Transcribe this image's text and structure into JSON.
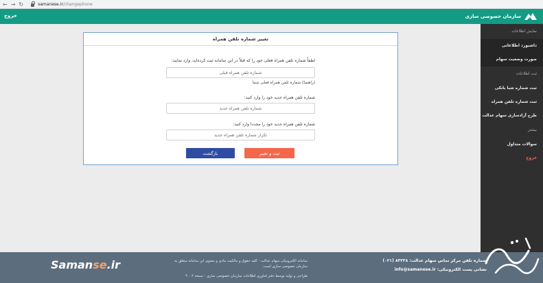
{
  "browser": {
    "back_glyph": "←",
    "forward_glyph": "→",
    "reload_glyph": "↻",
    "url_host": "samanese.ir",
    "url_path": "/changephone"
  },
  "header": {
    "logout_label": "خروج",
    "brand_name": "سازمان خصوصی سازی"
  },
  "sidebar": {
    "items": [
      {
        "label": "نمایش اطلاعات",
        "kind": "section"
      },
      {
        "label": "داشبورد اطلاعاتی",
        "kind": "item"
      },
      {
        "label": "صورت وضعیت سهام",
        "kind": "item"
      },
      {
        "label": "ثبت اطلاعات",
        "kind": "section"
      },
      {
        "label": "ثبت شماره شبا بانکی",
        "kind": "item"
      },
      {
        "label": "ثبت شماره تلفن همراه",
        "kind": "item"
      },
      {
        "label": "طرح آزادسازی سهام عدالت",
        "kind": "item"
      },
      {
        "label": "بیشتر",
        "kind": "section"
      },
      {
        "label": "سوالات متداول",
        "kind": "item"
      },
      {
        "label": "خروج",
        "kind": "exit"
      }
    ]
  },
  "form": {
    "title": "تغییر شماره تلفن همراه",
    "current_label": "لطفاً شماره تلفن همراه فعلی خود را که قبلاً در این سامانه ثبت کرده‌اید، وارد نمایید:",
    "current_placeholder": "شماره تلفن همراه قبلی",
    "current_hint": "(راهنما) شماره تلفن همراه فعلی شما",
    "new_label": "شماره تلفن همراه جدید خود را وارد کنید:",
    "new_placeholder": "شماره تلفن همراه جدید",
    "repeat_label": "شماره تلفن همراه جدید خود را مجددا وارد کنید:",
    "repeat_placeholder": "تکرار شماره تلفن همراه جدید",
    "submit_label": "ثبت و تغییر",
    "back_label": "بازگشت"
  },
  "footer": {
    "logo_main": "Saman",
    "logo_accent": "se",
    "logo_tail": ".ir",
    "notice": "سامانه الکترونیکی سهام عدالت - کلیه حقوق و مالکیت مادی و معنوی این سامانه متعلق به سازمان خصوصی سازی است.",
    "credit": "طراحی و تولید توسط دفتر فناوری اطلاعات سازمان خصوصی سازی - نسخه ۴.۰.۲",
    "phone_line": "شماره تلفن مرکز تماس سهام عدالت: ۸۳۳۳۸ (۰۲۱)",
    "email_label": "نشانی پست الکترونیکی:",
    "email": "info@samanese.ir"
  },
  "colors": {
    "header_bg": "#149b84",
    "sidebar_bg": "#2f2f2f",
    "submit_bg": "#f4674a",
    "back_bg": "#2f4ca3",
    "footer_bg": "#5c6d7d",
    "card_border": "#6fa3d4"
  }
}
